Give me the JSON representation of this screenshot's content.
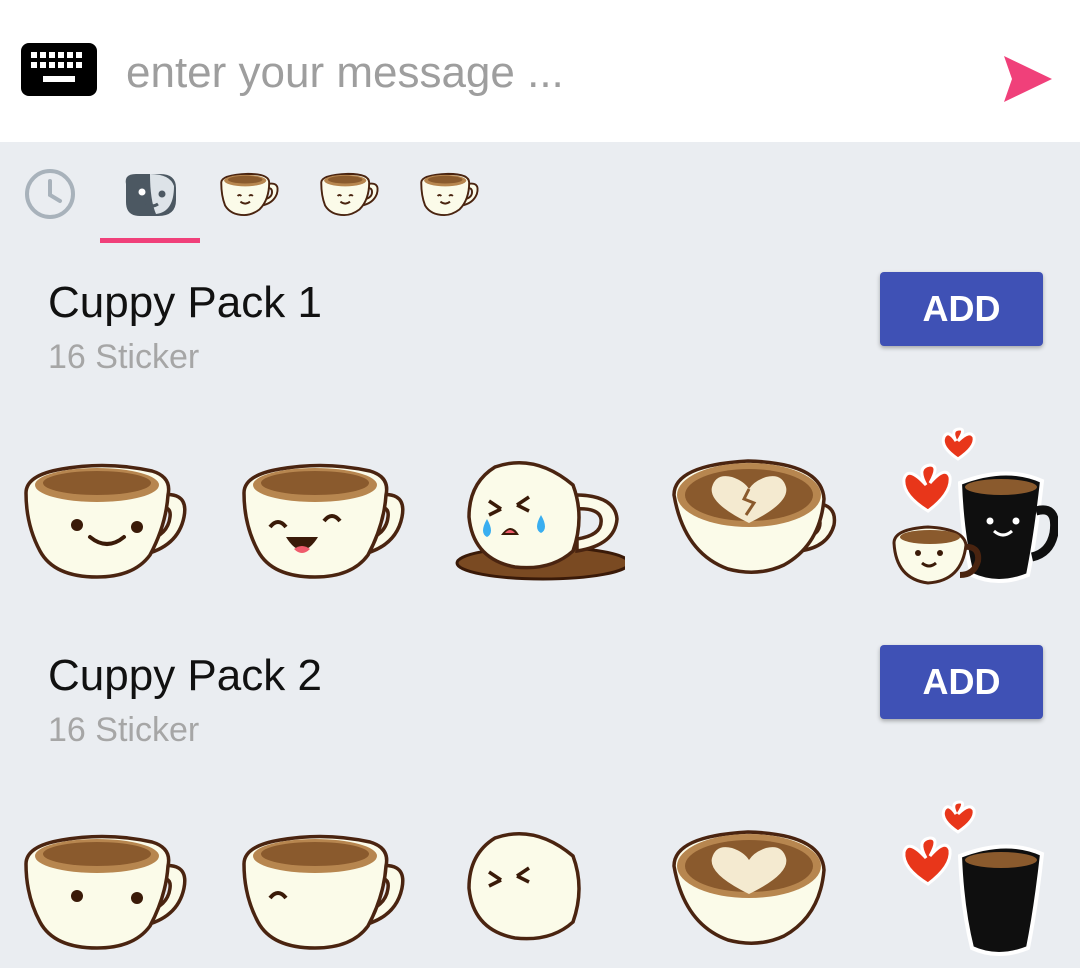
{
  "composer": {
    "placeholder": "enter your message ...",
    "keyboard_icon": "keyboard-icon",
    "send_icon": "send-icon",
    "accent_color": "#f0407a"
  },
  "tabs": [
    {
      "name": "recent",
      "icon": "clock-icon"
    },
    {
      "name": "sticker-store",
      "icon": "sticker-face-icon",
      "selected": true
    },
    {
      "name": "cuppy-1",
      "icon": "cup-sticker-icon"
    },
    {
      "name": "cuppy-2",
      "icon": "cup-sticker-icon"
    },
    {
      "name": "cuppy-3",
      "icon": "cup-sticker-icon"
    }
  ],
  "packs": [
    {
      "title": "Cuppy Pack 1",
      "count": "16 Sticker",
      "button": "ADD",
      "stickers": [
        "smiling-cup",
        "laughing-cup",
        "crying-spilled-cup",
        "latte-broken-heart-cup",
        "cups-in-love"
      ]
    },
    {
      "title": "Cuppy Pack 2",
      "count": "16 Sticker",
      "button": "ADD",
      "stickers": [
        "smiling-cup",
        "laughing-cup",
        "crying-spilled-cup",
        "latte-broken-heart-cup",
        "cups-in-love"
      ]
    }
  ],
  "button_color": "#3f51b5"
}
